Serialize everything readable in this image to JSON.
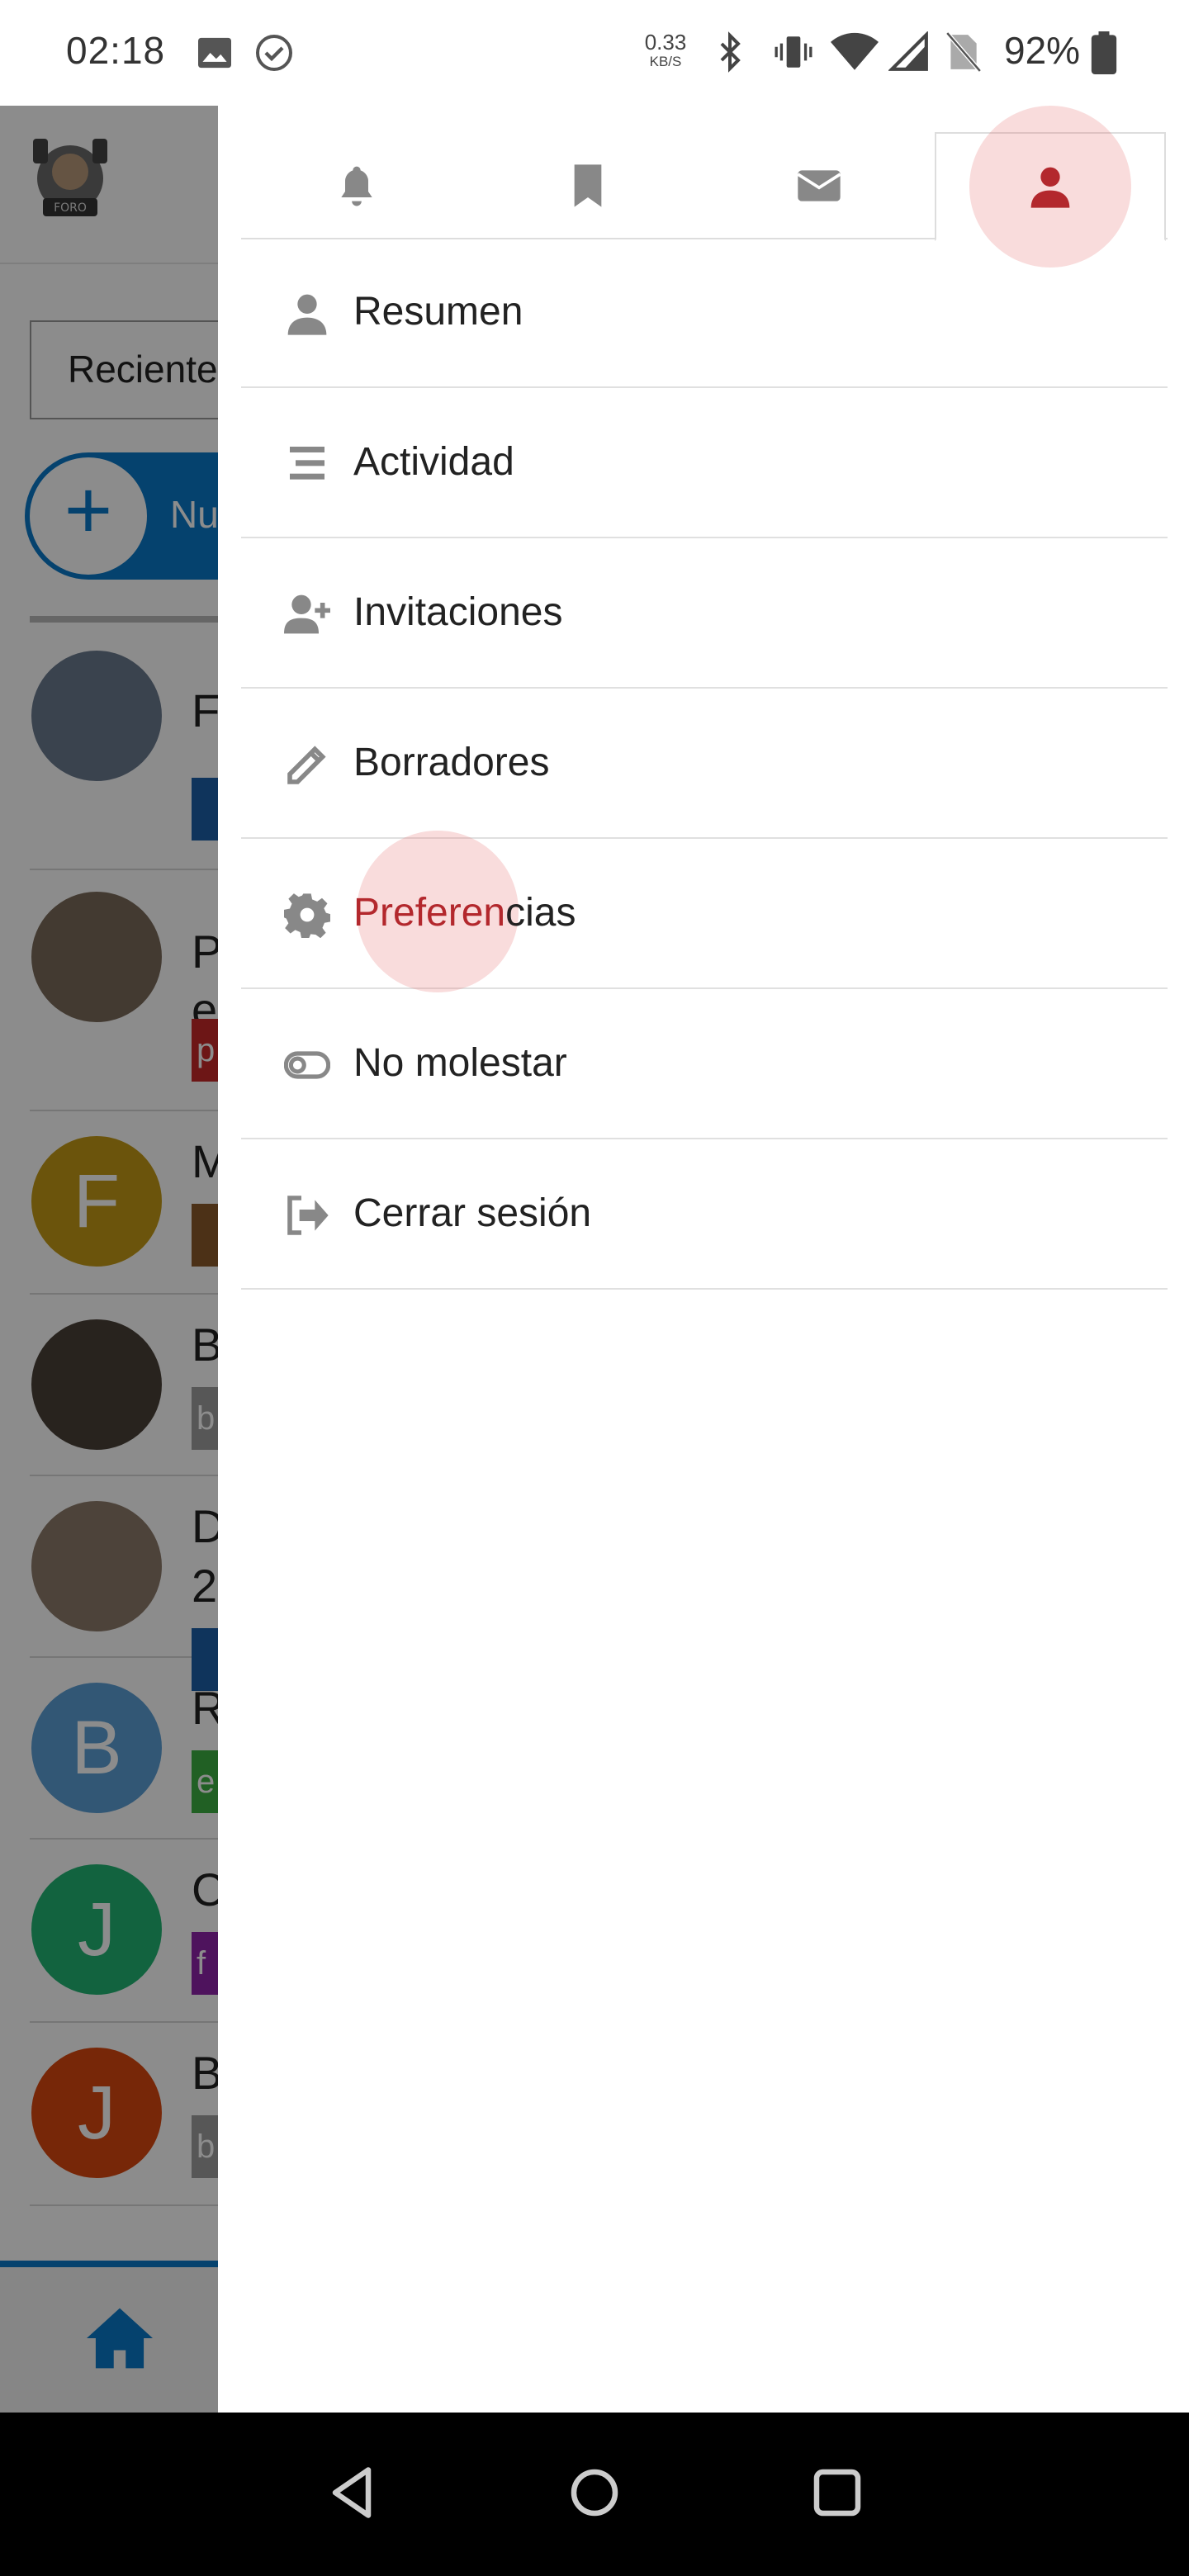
{
  "status_bar": {
    "time": "02:18",
    "net_speed_value": "0.33",
    "net_speed_unit": "KB/S",
    "battery": "92%",
    "icons": [
      "image-icon",
      "check-circle-icon",
      "bluetooth-icon",
      "vibrate-icon",
      "wifi-icon",
      "signal-icon",
      "no-sim-icon",
      "battery-icon"
    ]
  },
  "app": {
    "filter_dropdown": "Reciente",
    "new_topic_label": "Nu",
    "rows": [
      {
        "title": "F",
        "avatar_letter": "",
        "avatar_color": "#6b7a8f",
        "tag_color": "#1d5fa8"
      },
      {
        "title": "P",
        "title_2": "e",
        "avatar_letter": "",
        "avatar_color": "#7a6a5a",
        "tag_color": "#c62828",
        "tag_text": "p"
      },
      {
        "title": "M",
        "avatar_letter": "F",
        "avatar_color": "#c49a16",
        "tag_color": "#8a5a2b"
      },
      {
        "title": "B",
        "avatar_letter": "",
        "avatar_color": "#4a4038",
        "tag_color": "#9e9e9e",
        "tag_text": "b"
      },
      {
        "title": "D",
        "title_2": "2",
        "avatar_letter": "",
        "avatar_color": "#8d7a6a",
        "tag_color": "#1d5fa8"
      },
      {
        "title": "R",
        "avatar_letter": "B",
        "avatar_color": "#5b9fd6",
        "tag_color": "#3cb043",
        "tag_text": "e"
      },
      {
        "title": "C",
        "avatar_letter": "J",
        "avatar_color": "#22b573",
        "tag_color": "#8e24aa",
        "tag_text": "f"
      },
      {
        "title": "B",
        "avatar_letter": "J",
        "avatar_color": "#d9480f",
        "tag_color": "#9e9e9e",
        "tag_text": "b"
      }
    ]
  },
  "drawer": {
    "tabs": [
      {
        "name": "notifications",
        "icon": "bell-icon"
      },
      {
        "name": "bookmarks",
        "icon": "bookmark-icon"
      },
      {
        "name": "messages",
        "icon": "envelope-icon"
      },
      {
        "name": "profile",
        "icon": "user-icon",
        "active": true
      }
    ],
    "menu": [
      {
        "label": "Resumen",
        "icon": "user-icon"
      },
      {
        "label": "Actividad",
        "icon": "list-icon"
      },
      {
        "label": "Invitaciones",
        "icon": "user-plus-icon"
      },
      {
        "label": "Borradores",
        "icon": "pencil-icon"
      },
      {
        "label": "Preferencias",
        "label_highlight": "Preferen",
        "label_rest": "cias",
        "icon": "gear-icon",
        "selected": true
      },
      {
        "label": "No molestar",
        "icon": "toggle-icon"
      },
      {
        "label": "Cerrar sesión",
        "icon": "sign-out-icon"
      }
    ]
  },
  "colors": {
    "accent": "#b3282d",
    "primary": "#0a79c8",
    "icon_grey": "#888888"
  }
}
